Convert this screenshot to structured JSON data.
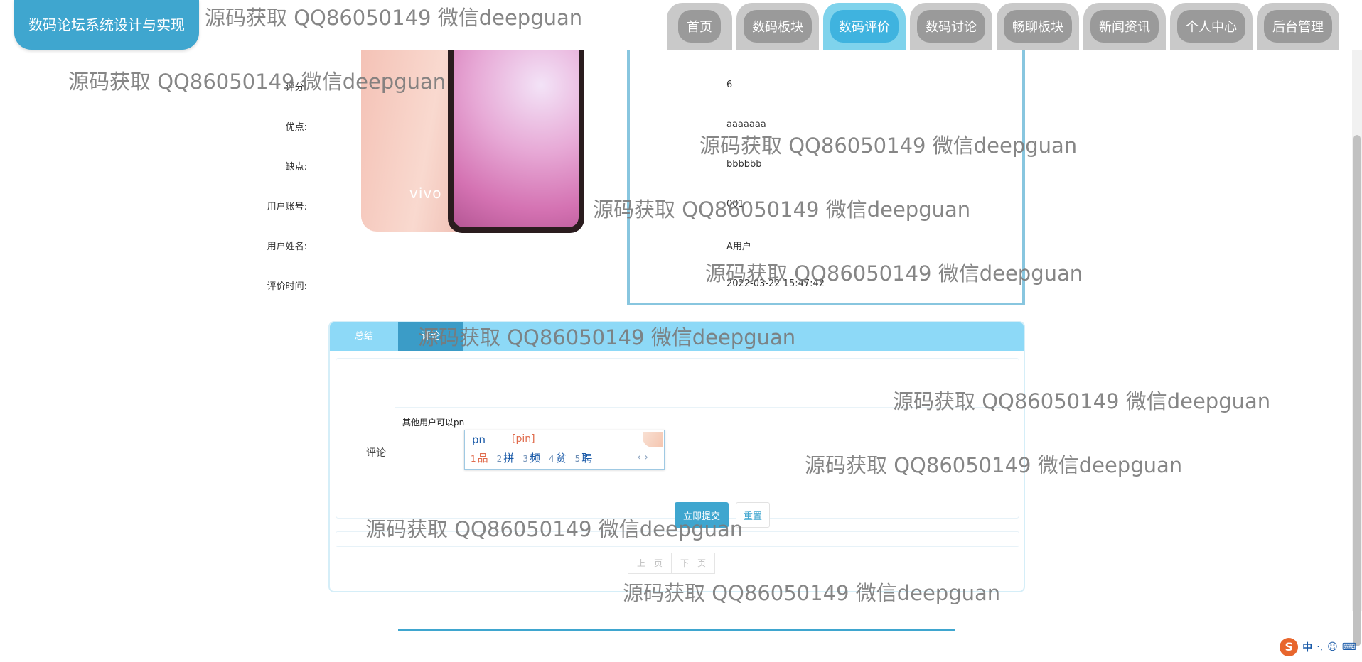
{
  "site": {
    "title": "数码论坛系统设计与实现"
  },
  "nav": {
    "items": [
      {
        "label": "首页",
        "active": false
      },
      {
        "label": "数码板块",
        "active": false
      },
      {
        "label": "数码评价",
        "active": true
      },
      {
        "label": "数码讨论",
        "active": false
      },
      {
        "label": "畅聊板块",
        "active": false
      },
      {
        "label": "新闻资讯",
        "active": false
      },
      {
        "label": "个人中心",
        "active": false
      },
      {
        "label": "后台管理",
        "active": false
      }
    ]
  },
  "product": {
    "brand_text": "vivo"
  },
  "detail": {
    "fields": [
      {
        "label": "评分:",
        "value": "6"
      },
      {
        "label": "优点:",
        "value": "aaaaaaa"
      },
      {
        "label": "缺点:",
        "value": "bbbbbb"
      },
      {
        "label": "用户账号:",
        "value": "001"
      },
      {
        "label": "用户姓名:",
        "value": "A用户"
      },
      {
        "label": "评价时间:",
        "value": "2022-03-22 15:47:42"
      }
    ]
  },
  "comments": {
    "tabs": [
      "总结",
      "评论"
    ],
    "label": "评论",
    "textarea_value": "其他用户可以pn",
    "submit_label": "立即提交",
    "reset_label": "重置",
    "pager": {
      "prev": "上一页",
      "next": "下一页"
    }
  },
  "ime": {
    "typed": "pn",
    "pinyin": "[pin]",
    "candidates": [
      {
        "num": "1",
        "char": "品"
      },
      {
        "num": "2",
        "char": "拼"
      },
      {
        "num": "3",
        "char": "频"
      },
      {
        "num": "4",
        "char": "贫"
      },
      {
        "num": "5",
        "char": "聘"
      }
    ],
    "arrows": "‹ ›"
  },
  "watermark": {
    "text": "源码获取 QQ86050149 微信deepguan"
  },
  "tray": {
    "lang": "中",
    "punct": "·,",
    "icons": [
      "smile-icon",
      "keyboard-icon"
    ]
  },
  "colors": {
    "accent": "#3fa6cf",
    "tab_bar": "#8dd9f7",
    "nav_active": "#7fd3ec",
    "nav_inactive": "#c9c9c9"
  }
}
